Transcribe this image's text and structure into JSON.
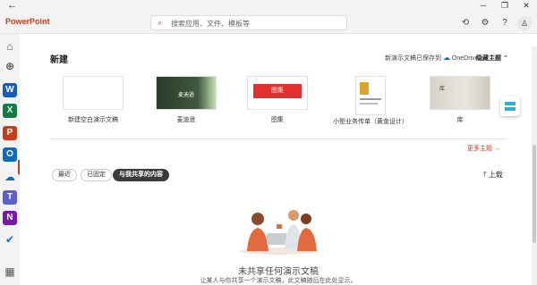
{
  "window": {
    "back_glyph": "←",
    "minimize": "─",
    "restore": "❐",
    "close": "✕"
  },
  "appbar": {
    "app_name": "PowerPoint",
    "search_placeholder": "搜索应用、文件、模板等",
    "icons": [
      "copilot-icon",
      "settings-icon",
      "help-icon",
      "account-icon"
    ]
  },
  "sidebar": {
    "items": [
      {
        "name": "home",
        "glyph": "⌂",
        "color": "#555555"
      },
      {
        "name": "create",
        "glyph": "⊕",
        "color": "#555555"
      },
      {
        "name": "word",
        "glyph": "W",
        "color": "#185abd"
      },
      {
        "name": "excel",
        "glyph": "X",
        "color": "#107c41"
      },
      {
        "name": "powerpoint",
        "glyph": "P",
        "color": "#c43e1c"
      },
      {
        "name": "outlook",
        "glyph": "O",
        "color": "#0f6cbd"
      },
      {
        "name": "onedrive",
        "glyph": "☁",
        "color": "#0f6cbd"
      },
      {
        "name": "teams",
        "glyph": "T",
        "color": "#5b5fc7"
      },
      {
        "name": "onenote",
        "glyph": "N",
        "color": "#7719aa"
      },
      {
        "name": "todo",
        "glyph": "✔",
        "color": "#2564cf"
      },
      {
        "name": "more-apps",
        "glyph": "▦",
        "color": "#555555"
      }
    ]
  },
  "new_section": {
    "title": "新建",
    "onedrive_note": "新演示文稿已保存到",
    "onedrive_label": "OneDrive",
    "hide_themes": "隐藏主题",
    "templates": [
      {
        "label": "新建空白演示文稿",
        "thumb_text": ""
      },
      {
        "label": "麦迪逊",
        "thumb_text": "麦迪逊"
      },
      {
        "label": "图集",
        "thumb_text": "图集"
      },
      {
        "label": "小型业务传单（黄金设计）",
        "thumb_text": ""
      },
      {
        "label": "库",
        "thumb_text": "库"
      }
    ],
    "more_themes": "更多主题"
  },
  "files": {
    "tabs": [
      "最近",
      "已固定",
      "与我共享的内容"
    ],
    "active_tab": 2,
    "upload": "上载",
    "empty_title": "未共享任何演示文稿",
    "empty_sub": "让某人与你共享一个演示文稿，此文稿随后在此处显示。"
  },
  "colors": {
    "accent": "#c43e1c",
    "onedrive": "#0f6cbd"
  }
}
